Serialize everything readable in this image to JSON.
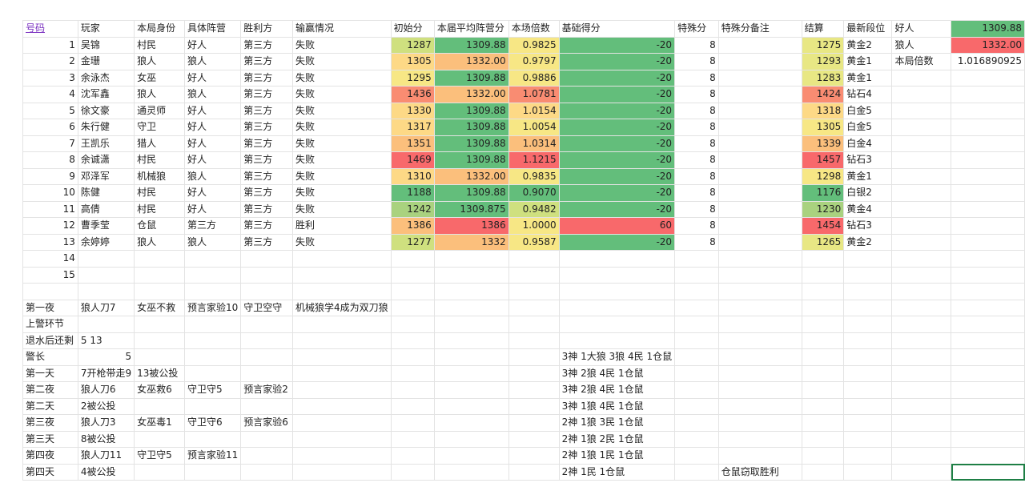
{
  "colors": {
    "green": "#63be7b",
    "light_green": "#a9d27f",
    "yellow_green": "#cfe07f",
    "yellow": "#f7e785",
    "yellow_orange": "#fdd986",
    "orange": "#fbbf7c",
    "salmon": "#f98c72",
    "red": "#f8696b",
    "pale_yellow": "#e8e784"
  },
  "sheet": {
    "rows": [
      [
        "号码",
        "玩家",
        "本局身份",
        "具体阵营",
        "胜利方",
        "输赢情况",
        "初始分",
        "本届平均阵营分",
        "本场倍数",
        "基础得分",
        "特殊分",
        "特殊分备注",
        "结算",
        "最新段位",
        "好人",
        "1309.88"
      ],
      [
        "1",
        "吴锦",
        "村民",
        "好人",
        "第三方",
        "失败",
        "1287",
        "1309.88",
        "0.9825",
        "-20",
        "8",
        "",
        "1275",
        "黄金2",
        "狼人",
        "1332.00"
      ],
      [
        "2",
        "金珊",
        "狼人",
        "狼人",
        "第三方",
        "失败",
        "1305",
        "1332.00",
        "0.9797",
        "-20",
        "8",
        "",
        "1293",
        "黄金1",
        "本局倍数",
        "1.016890925"
      ],
      [
        "3",
        "余泳杰",
        "女巫",
        "好人",
        "第三方",
        "失败",
        "1295",
        "1309.88",
        "0.9886",
        "-20",
        "8",
        "",
        "1283",
        "黄金1",
        "",
        ""
      ],
      [
        "4",
        "沈军鑫",
        "狼人",
        "狼人",
        "第三方",
        "失败",
        "1436",
        "1332.00",
        "1.0781",
        "-20",
        "8",
        "",
        "1424",
        "钻石4",
        "",
        ""
      ],
      [
        "5",
        "徐文豪",
        "通灵师",
        "好人",
        "第三方",
        "失败",
        "1330",
        "1309.88",
        "1.0154",
        "-20",
        "8",
        "",
        "1318",
        "白金5",
        "",
        ""
      ],
      [
        "6",
        "朱行健",
        "守卫",
        "好人",
        "第三方",
        "失败",
        "1317",
        "1309.88",
        "1.0054",
        "-20",
        "8",
        "",
        "1305",
        "白金5",
        "",
        ""
      ],
      [
        "7",
        "王凯乐",
        "猎人",
        "好人",
        "第三方",
        "失败",
        "1351",
        "1309.88",
        "1.0314",
        "-20",
        "8",
        "",
        "1339",
        "白金4",
        "",
        ""
      ],
      [
        "8",
        "余诚潇",
        "村民",
        "好人",
        "第三方",
        "失败",
        "1469",
        "1309.88",
        "1.1215",
        "-20",
        "8",
        "",
        "1457",
        "钻石3",
        "",
        ""
      ],
      [
        "9",
        "邓泽军",
        "机械狼",
        "狼人",
        "第三方",
        "失败",
        "1310",
        "1332.00",
        "0.9835",
        "-20",
        "8",
        "",
        "1298",
        "黄金1",
        "",
        ""
      ],
      [
        "10",
        "陈健",
        "村民",
        "好人",
        "第三方",
        "失败",
        "1188",
        "1309.88",
        "0.9070",
        "-20",
        "8",
        "",
        "1176",
        "白银2",
        "",
        ""
      ],
      [
        "11",
        "高倩",
        "村民",
        "好人",
        "第三方",
        "失败",
        "1242",
        "1309.875",
        "0.9482",
        "-20",
        "8",
        "",
        "1230",
        "黄金4",
        "",
        ""
      ],
      [
        "12",
        "曹季莹",
        "仓鼠",
        "第三方",
        "第三方",
        "胜利",
        "1386",
        "1386",
        "1.0000",
        "60",
        "8",
        "",
        "1454",
        "钻石3",
        "",
        ""
      ],
      [
        "13",
        "余婷婷",
        "狼人",
        "狼人",
        "第三方",
        "失败",
        "1277",
        "1332",
        "0.9587",
        "-20",
        "8",
        "",
        "1265",
        "黄金2",
        "",
        ""
      ],
      [
        "14",
        "",
        "",
        "",
        "",
        "",
        "",
        "",
        "",
        "",
        "",
        "",
        "",
        "",
        "",
        ""
      ],
      [
        "15",
        "",
        "",
        "",
        "",
        "",
        "",
        "",
        "",
        "",
        "",
        "",
        "",
        "",
        "",
        ""
      ],
      [
        "",
        "",
        "",
        "",
        "",
        "",
        "",
        "",
        "",
        "",
        "",
        "",
        "",
        "",
        "",
        ""
      ],
      [
        "第一夜",
        "狼人刀7",
        "女巫不救",
        "预言家验10",
        "守卫空守",
        "机械狼学4成为双刀狼",
        "",
        "",
        "",
        "",
        "",
        "",
        "",
        "",
        "",
        ""
      ],
      [
        "上警环节",
        "",
        "",
        "",
        "",
        "",
        "",
        "",
        "",
        "",
        "",
        "",
        "",
        "",
        "",
        ""
      ],
      [
        "退水后还剩",
        "5 13",
        "",
        "",
        "",
        "",
        "",
        "",
        "",
        "",
        "",
        "",
        "",
        "",
        "",
        ""
      ],
      [
        "警长",
        "5",
        "",
        "",
        "",
        "",
        "",
        "",
        "",
        "3神 1大狼 3狼 4民 1仓鼠",
        "",
        "",
        "",
        "",
        "",
        ""
      ],
      [
        "第一天",
        "7开枪带走9",
        "13被公投",
        "",
        "",
        "",
        "",
        "",
        "",
        "3神 2狼 4民 1仓鼠",
        "",
        "",
        "",
        "",
        "",
        ""
      ],
      [
        "第二夜",
        "狼人刀6",
        "女巫救6",
        "守卫守5",
        "预言家验2",
        "",
        "",
        "",
        "",
        "3神 2狼 4民 1仓鼠",
        "",
        "",
        "",
        "",
        "",
        ""
      ],
      [
        "第二天",
        "2被公投",
        "",
        "",
        "",
        "",
        "",
        "",
        "",
        "3神 1狼 4民 1仓鼠",
        "",
        "",
        "",
        "",
        "",
        ""
      ],
      [
        "第三夜",
        "狼人刀3",
        "女巫毒1",
        "守卫守6",
        "预言家验6",
        "",
        "",
        "",
        "",
        "2神 1狼 3民 1仓鼠",
        "",
        "",
        "",
        "",
        "",
        ""
      ],
      [
        "第三天",
        "8被公投",
        "",
        "",
        "",
        "",
        "",
        "",
        "",
        "2神 1狼 2民 1仓鼠",
        "",
        "",
        "",
        "",
        "",
        ""
      ],
      [
        "第四夜",
        "狼人刀11",
        "守卫守5",
        "预言家验11",
        "",
        "",
        "",
        "",
        "",
        "2神 1狼 1民 1仓鼠",
        "",
        "",
        "",
        "",
        "",
        ""
      ],
      [
        "第四天",
        "4被公投",
        "",
        "",
        "",
        "",
        "",
        "",
        "",
        "2神 1民 1仓鼠",
        "",
        "仓鼠窃取胜利",
        "",
        "",
        "",
        ""
      ]
    ],
    "fills": {
      "6": [
        "",
        "yellow_green",
        "yellow_orange",
        "yellow",
        "salmon",
        "yellow_orange",
        "yellow_orange",
        "orange",
        "red",
        "yellow_orange",
        "green",
        "light_green",
        "orange",
        "yellow_green"
      ],
      "7": [
        "",
        "green",
        "orange",
        "green",
        "orange",
        "green",
        "green",
        "green",
        "green",
        "orange",
        "green",
        "green",
        "red",
        "orange"
      ],
      "8": [
        "",
        "yellow",
        "yellow",
        "yellow",
        "salmon",
        "yellow_orange",
        "yellow",
        "orange",
        "red",
        "yellow",
        "green",
        "yellow_green",
        "yellow",
        "yellow"
      ],
      "9": [
        "",
        "green",
        "green",
        "green",
        "green",
        "green",
        "green",
        "green",
        "green",
        "green",
        "green",
        "green",
        "red",
        "green"
      ],
      "12": [
        "",
        "pale_yellow",
        "pale_yellow",
        "pale_yellow",
        "salmon",
        "yellow_orange",
        "yellow",
        "orange",
        "red",
        "yellow",
        "green",
        "light_green",
        "red",
        "pale_yellow"
      ],
      "15": [
        "green",
        "red",
        "",
        "",
        "",
        "",
        "",
        "",
        "",
        "",
        "",
        "",
        "",
        "",
        "",
        ""
      ]
    }
  }
}
